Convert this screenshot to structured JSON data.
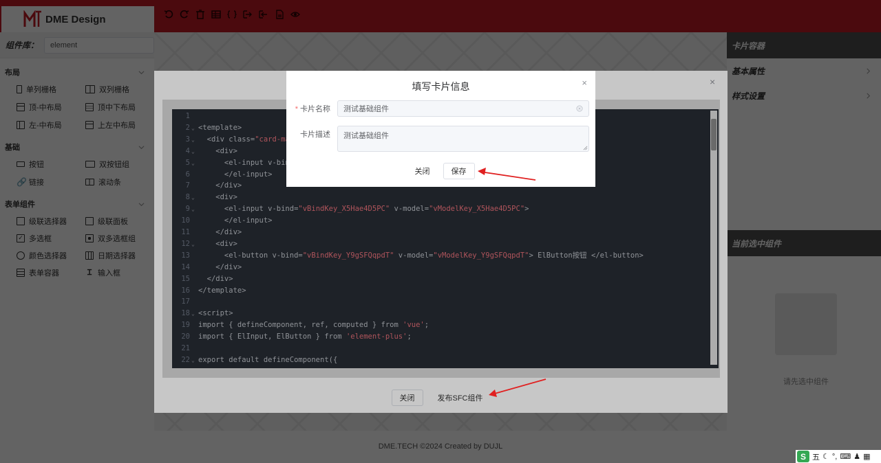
{
  "app": {
    "brand": "DME Design",
    "footer": "DME.TECH ©2024 Created by DUJL",
    "accent_color": "#c21a24"
  },
  "toolbar": {
    "icons": [
      "undo-icon",
      "redo-icon",
      "delete-icon",
      "table-icon",
      "code-braces-icon",
      "import-icon",
      "export-icon",
      "file-icon",
      "preview-eye-icon"
    ]
  },
  "sidebar": {
    "library_label": "组件库：",
    "library_value": "element",
    "groups": [
      {
        "title": "布局",
        "items": [
          "单列栅格",
          "双列栅格",
          "顶-中布局",
          "顶中下布局",
          "左-中布局",
          "上左中布局"
        ]
      },
      {
        "title": "基础",
        "items": [
          "按钮",
          "双按钮组",
          "链接",
          "滚动条"
        ]
      },
      {
        "title": "表单组件",
        "items": [
          "级联选择器",
          "级联面板",
          "多选框",
          "双多选框组",
          "颜色选择器",
          "日期选择器",
          "表单容器",
          "输入框"
        ]
      }
    ]
  },
  "right_panel": {
    "header": "卡片容器",
    "rows": [
      "基本属性",
      "样式设置"
    ],
    "selected_header": "当前选中组件",
    "empty_text": "请先选中组件"
  },
  "sfc_dialog": {
    "close_label": "关闭",
    "publish_label": "发布SFC组件",
    "code_lines": [
      {
        "n": "1",
        "fold": "",
        "text": ""
      },
      {
        "n": "2",
        "fold": "⌄",
        "text": "<template>"
      },
      {
        "n": "3",
        "fold": "⌄",
        "text": "  <div class=\"card-ma"
      },
      {
        "n": "4",
        "fold": "⌄",
        "text": "    <div>"
      },
      {
        "n": "5",
        "fold": "⌄",
        "text": "      <el-input v-bind"
      },
      {
        "n": "6",
        "fold": "",
        "text": "      </el-input>"
      },
      {
        "n": "7",
        "fold": "",
        "text": "    </div>"
      },
      {
        "n": "8",
        "fold": "⌄",
        "text": "    <div>"
      },
      {
        "n": "9",
        "fold": "⌄",
        "text": "      <el-input v-bind=\"vBindKey_X5Hae4D5PC\" v-model=\"vModelKey_X5Hae4D5PC\">"
      },
      {
        "n": "10",
        "fold": "",
        "text": "      </el-input>"
      },
      {
        "n": "11",
        "fold": "",
        "text": "    </div>"
      },
      {
        "n": "12",
        "fold": "⌄",
        "text": "    <div>"
      },
      {
        "n": "13",
        "fold": "",
        "text": "      <el-button v-bind=\"vBindKey_Y9gSFQqpdT\" v-model=\"vModelKey_Y9gSFQqpdT\"> ElButton按钮 </el-button>"
      },
      {
        "n": "14",
        "fold": "",
        "text": "    </div>"
      },
      {
        "n": "15",
        "fold": "",
        "text": "  </div>"
      },
      {
        "n": "16",
        "fold": "",
        "text": "</template>"
      },
      {
        "n": "17",
        "fold": "",
        "text": ""
      },
      {
        "n": "18",
        "fold": "⌄",
        "text": "<script>"
      },
      {
        "n": "19",
        "fold": "",
        "text": "import { defineComponent, ref, computed } from 'vue';"
      },
      {
        "n": "20",
        "fold": "",
        "text": "import { ElInput, ElButton } from 'element-plus';"
      },
      {
        "n": "21",
        "fold": "",
        "text": ""
      },
      {
        "n": "22",
        "fold": "⌄",
        "text": "export default defineComponent({"
      }
    ]
  },
  "card_dialog": {
    "title": "填写卡片信息",
    "name_label": "卡片名称",
    "name_required_mark": "*",
    "name_value": "测试基础组件",
    "desc_label": "卡片描述",
    "desc_value": "测试基础组件",
    "close_label": "关闭",
    "save_label": "保存"
  },
  "ime": {
    "logo": "S",
    "mode": "五"
  }
}
